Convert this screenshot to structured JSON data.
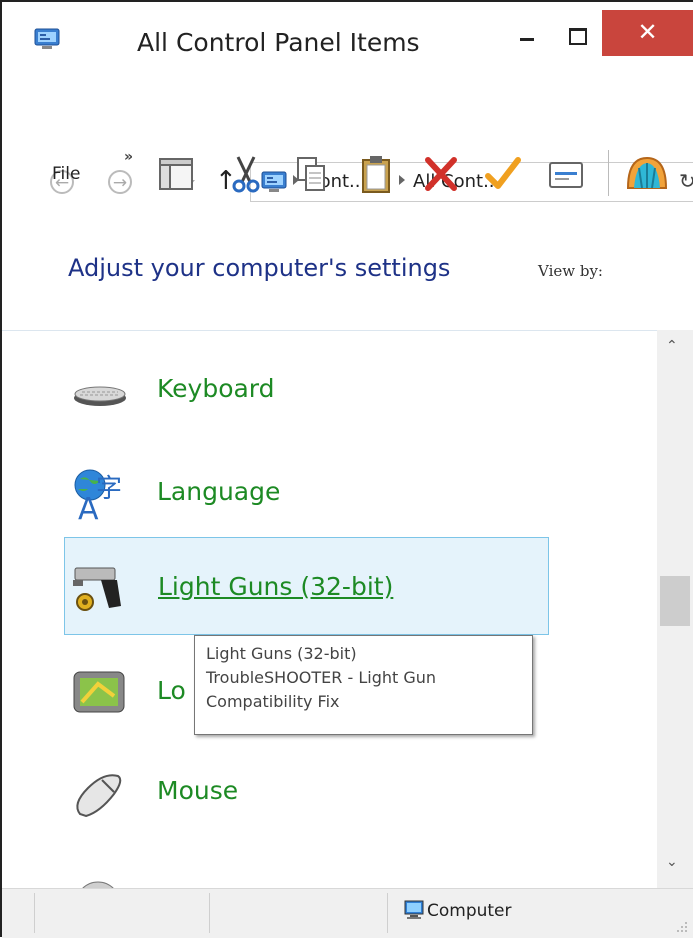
{
  "window": {
    "title": "All Control Panel Items",
    "minimize_glyph": "–",
    "close_glyph": "✕"
  },
  "address": {
    "crumbs": [
      "Cont...",
      "All Cont..."
    ]
  },
  "toolbar": {
    "file_label": "File",
    "more_glyph": "»",
    "icons": [
      "pane-icon",
      "cut-icon",
      "copy-icon",
      "paste-icon",
      "delete-icon",
      "checkmark-icon",
      "properties-icon",
      "shell-icon"
    ]
  },
  "header": {
    "heading": "Adjust your computer's settings",
    "view_by": "View by:"
  },
  "items": [
    {
      "label": "Keyboard",
      "icon": "keyboard-icon"
    },
    {
      "label": "Language",
      "icon": "language-icon"
    },
    {
      "label": "Light Guns (32-bit)",
      "icon": "light-gun-icon",
      "selected": true
    },
    {
      "label": "Lo",
      "icon": "location-icon"
    },
    {
      "label": "Mouse",
      "icon": "mouse-icon"
    },
    {
      "label": "",
      "icon": "partial-item-icon"
    }
  ],
  "tooltip": {
    "line1": "Light Guns (32-bit)",
    "line2": "TroubleSHOOTER - Light Gun",
    "line3": "Compatibility Fix"
  },
  "statusbar": {
    "location": "Computer"
  },
  "colors": {
    "link_green": "#1d8a24",
    "heading_blue": "#1e3287",
    "close_red": "#c9453d",
    "selection_bg": "#e5f3fb",
    "selection_border": "#7dc5e8"
  }
}
